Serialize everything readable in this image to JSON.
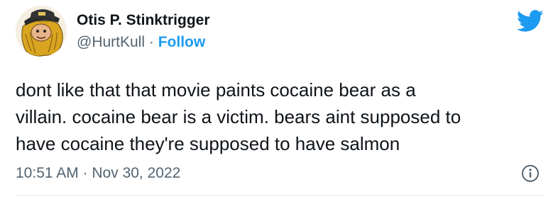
{
  "author": {
    "name": "Otis P. Stinktrigger",
    "handle": "@HurtKull",
    "separator": "·",
    "follow_label": "Follow",
    "avatar_icon": "avatar-cartoon-bearded-man"
  },
  "brand": {
    "icon": "twitter-bird-icon",
    "color": "#1d9bf0"
  },
  "tweet": {
    "lines": [
      "dont like that that movie paints cocaine bear as a",
      "villain. cocaine bear is a victim. bears aint supposed to",
      "have cocaine they're supposed to have salmon"
    ]
  },
  "meta": {
    "timestamp": "10:51 AM · Nov 30, 2022",
    "info_icon": "info-icon"
  }
}
